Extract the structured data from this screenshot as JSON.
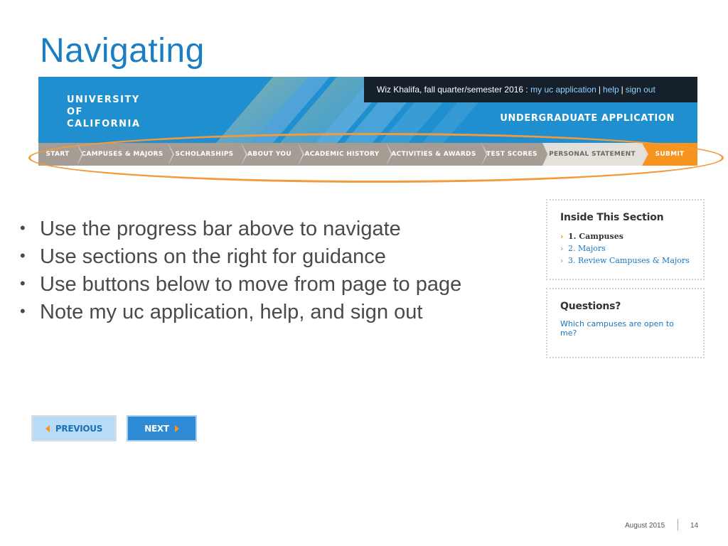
{
  "slide": {
    "title": "Navigating"
  },
  "header": {
    "logo_lines": [
      "UNIVERSITY",
      "OF",
      "CALIFORNIA"
    ],
    "user_text": "Wiz Khalifa, fall quarter/semester 2016 :",
    "links": [
      "my uc application",
      "help",
      "sign out"
    ],
    "link_separator": "|",
    "app_title": "UNDERGRADUATE APPLICATION"
  },
  "progress_bar": {
    "steps": [
      {
        "label": "START",
        "state": "done"
      },
      {
        "label": "CAMPUSES & MAJORS",
        "state": "done"
      },
      {
        "label": "SCHOLARSHIPS",
        "state": "done"
      },
      {
        "label": "ABOUT YOU",
        "state": "done"
      },
      {
        "label": "ACADEMIC HISTORY",
        "state": "done"
      },
      {
        "label": "ACTIVITIES & AWARDS",
        "state": "done"
      },
      {
        "label": "TEST SCORES",
        "state": "done"
      },
      {
        "label": "PERSONAL STATEMENT",
        "state": "current"
      },
      {
        "label": "SUBMIT",
        "state": "submit"
      }
    ]
  },
  "bullets": [
    "Use the progress bar above to navigate",
    "Use sections on the right for guidance",
    "Use buttons below to move from page to page",
    "Note my uc application, help, and sign out"
  ],
  "inside_section": {
    "title": "Inside This Section",
    "items": [
      "1. Campuses",
      "2. Majors",
      "3. Review Campuses & Majors"
    ],
    "active_index": 0
  },
  "questions": {
    "title": "Questions?",
    "link": "Which campuses are open to me?"
  },
  "buttons": {
    "previous": "PREVIOUS",
    "next": "NEXT"
  },
  "footer": {
    "date": "August 2015",
    "page": "14"
  },
  "colors": {
    "title": "#1b7ec2",
    "banner": "#1f8fd0",
    "highlight": "#f29a3c",
    "submit": "#f7941e",
    "link": "#1b76bf"
  }
}
